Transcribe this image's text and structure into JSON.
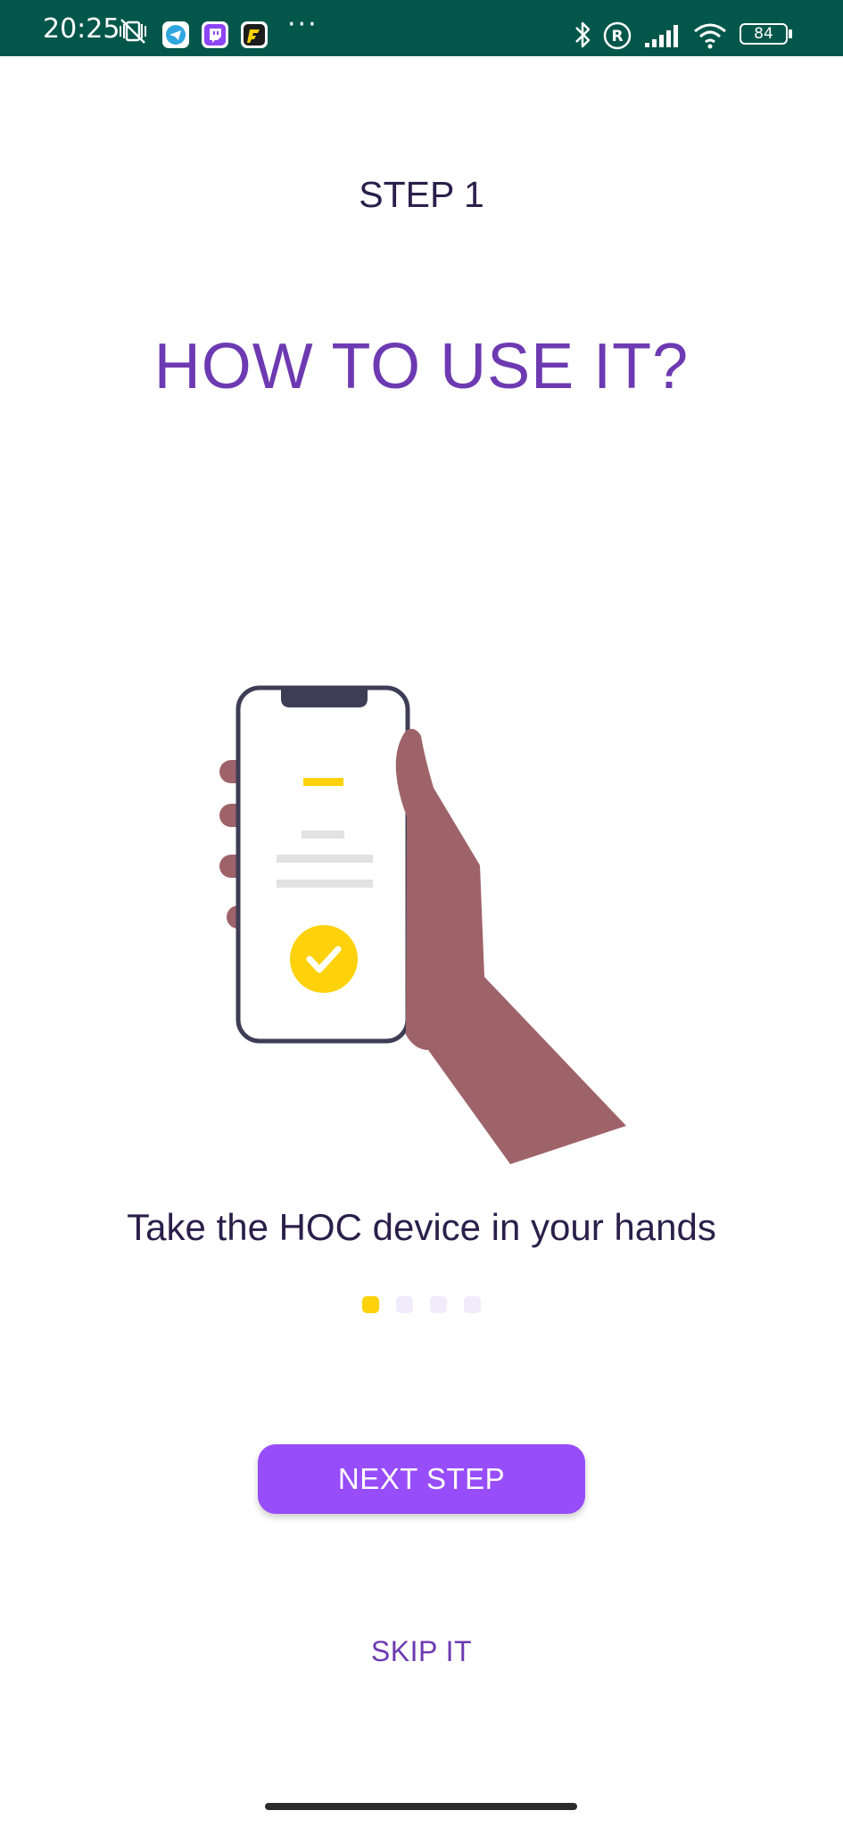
{
  "status_bar": {
    "time": "20:25",
    "battery": "84",
    "more": "···",
    "bg_color": "#03574a",
    "icons_left": [
      "vibrate-off-icon",
      "telegram-icon",
      "twitch-icon",
      "game-app-icon"
    ],
    "icons_right": [
      "bluetooth-icon",
      "registered-icon",
      "signal-icon",
      "wifi-icon",
      "battery-icon"
    ]
  },
  "onboarding": {
    "step_label": "STEP 1",
    "title": "HOW TO USE IT?",
    "caption": "Take the HOC device in your hands",
    "page_count": 4,
    "current_page": 1
  },
  "actions": {
    "next_label": "NEXT STEP",
    "skip_label": "SKIP IT"
  },
  "colors": {
    "accent": "#984dfb",
    "title": "#6d3ab2",
    "text": "#2b1f4a",
    "dot_active": "#fdd20a",
    "dot_inactive": "#f0ecfb",
    "skin": "#9e6369",
    "phone_frame": "#3f3d56"
  }
}
